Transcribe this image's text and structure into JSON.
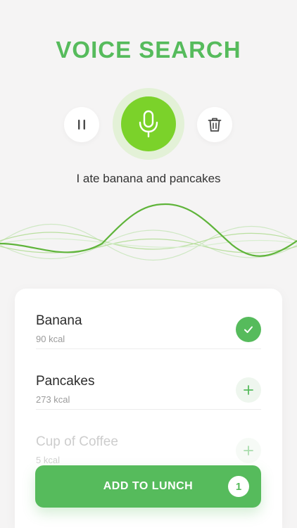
{
  "header": {
    "title": "VOICE SEARCH"
  },
  "controls": {
    "pause_icon": "pause-icon",
    "mic_icon": "microphone-icon",
    "trash_icon": "trash-icon"
  },
  "transcript": "I ate banana and pancakes",
  "colors": {
    "accent": "#56bb5c",
    "mic": "#7bd22a",
    "mic_halo": "#e3f1d7",
    "background": "#f5f4f4"
  },
  "results": [
    {
      "name": "Banana",
      "kcal": "90 kcal",
      "state": "selected",
      "icon": "check-icon"
    },
    {
      "name": "Pancakes",
      "kcal": "273 kcal",
      "state": "add",
      "icon": "plus-icon"
    },
    {
      "name": "Cup of Coffee",
      "kcal": "5 kcal",
      "state": "add",
      "icon": "plus-icon"
    }
  ],
  "footer": {
    "add_label": "ADD TO LUNCH",
    "count": "1"
  }
}
